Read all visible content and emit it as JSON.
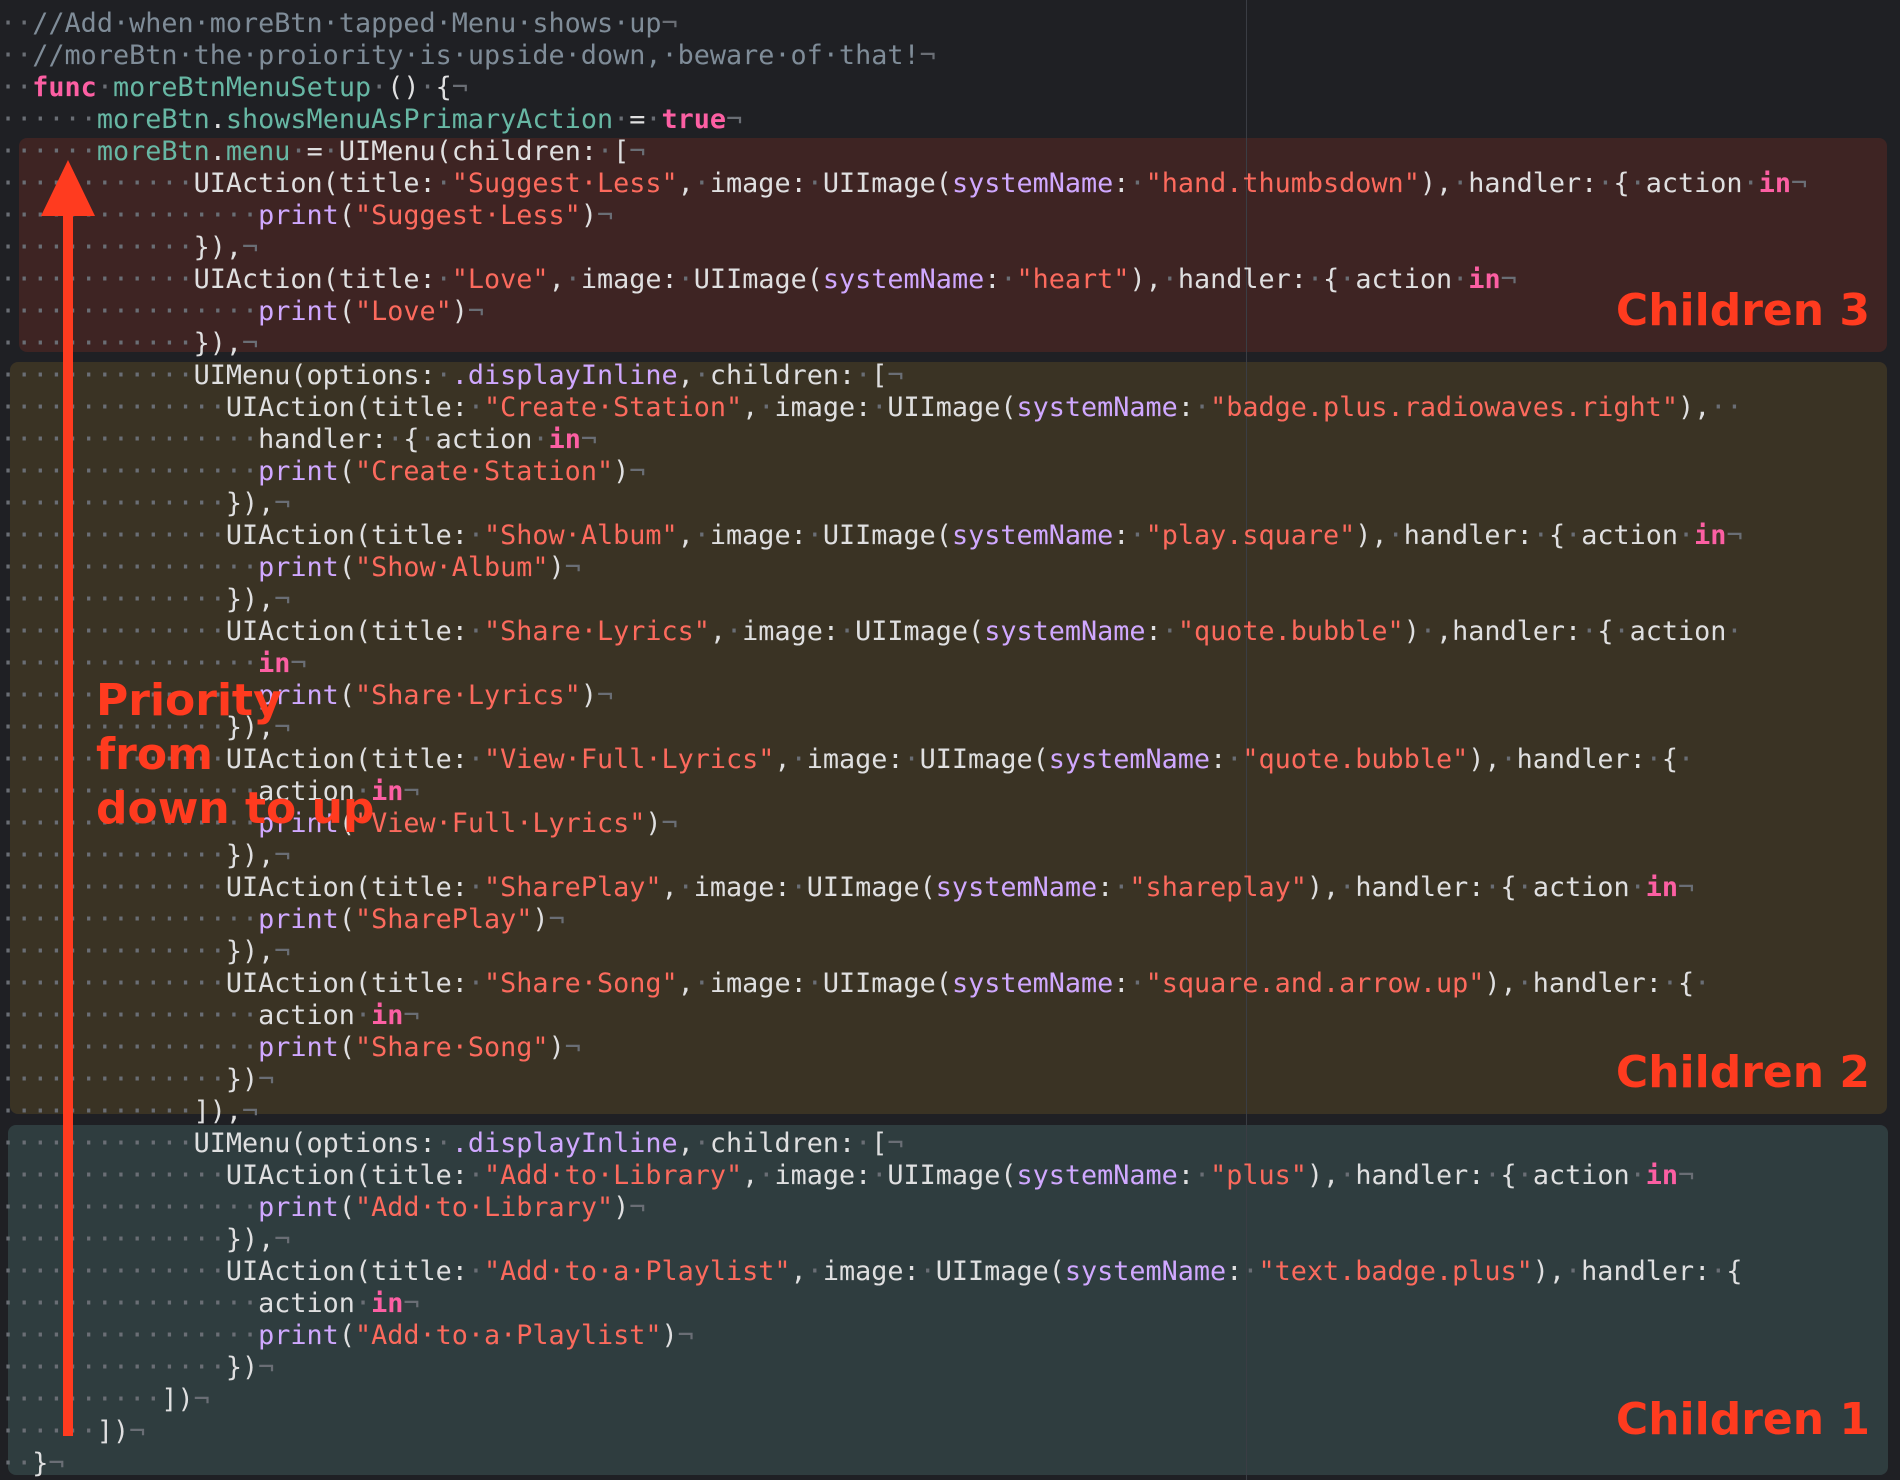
{
  "colors": {
    "background": "#1f2024",
    "region_children_3": "#3e2423",
    "region_children_2": "#3a3324",
    "region_children_1": "#2f3d3f",
    "annotation": "#ff3b1f",
    "keyword": "#fc5fa3",
    "string": "#fc6a5d",
    "type": "#d0a8ff",
    "property": "#67b7a4",
    "comment": "#7f8c98",
    "invisibles": "#6a6e75"
  },
  "annotations": {
    "children_3": "Children 3",
    "children_2": "Children 2",
    "children_1": "Children 1",
    "priority": "Priority\nfrom\ndown to up"
  },
  "code_lines": [
    [
      [
        "w",
        "··"
      ],
      [
        "c",
        "//Add·when·moreBtn·tapped·Menu·shows·up"
      ],
      [
        "p",
        "¬"
      ]
    ],
    [
      [
        "w",
        "··"
      ],
      [
        "c",
        "//moreBtn·the·proiority·is·upside·down,·beware·of·that!"
      ],
      [
        "p",
        "¬"
      ]
    ],
    [
      [
        "w",
        "··"
      ],
      [
        "k",
        "func"
      ],
      [
        "w",
        "·"
      ],
      [
        "f",
        "moreBtnMenuSetup"
      ],
      [
        "w",
        "·"
      ],
      [
        "t",
        "()"
      ],
      [
        "w",
        "·"
      ],
      [
        "t",
        "{"
      ],
      [
        "p",
        "¬"
      ]
    ],
    [
      [
        "w",
        "······"
      ],
      [
        "r",
        "moreBtn"
      ],
      [
        "t",
        "."
      ],
      [
        "r",
        "showsMenuAsPrimaryAction"
      ],
      [
        "w",
        "·"
      ],
      [
        "t",
        "="
      ],
      [
        "w",
        "·"
      ],
      [
        "k",
        "true"
      ],
      [
        "p",
        "¬"
      ]
    ],
    [
      [
        "w",
        "······"
      ],
      [
        "r",
        "moreBtn"
      ],
      [
        "t",
        "."
      ],
      [
        "r",
        "menu"
      ],
      [
        "w",
        "·"
      ],
      [
        "t",
        "="
      ],
      [
        "w",
        "·"
      ],
      [
        "t",
        "UIMenu(children:"
      ],
      [
        "w",
        "·"
      ],
      [
        "t",
        "["
      ],
      [
        "p",
        "¬"
      ]
    ],
    [
      [
        "w",
        "············"
      ],
      [
        "t",
        "UIAction(title:"
      ],
      [
        "w",
        "·"
      ],
      [
        "s",
        "\"Suggest·Less\""
      ],
      [
        "t",
        ","
      ],
      [
        "w",
        "·"
      ],
      [
        "t",
        "image:"
      ],
      [
        "w",
        "·"
      ],
      [
        "t",
        "UIImage("
      ],
      [
        "y",
        "systemName"
      ],
      [
        "t",
        ":"
      ],
      [
        "w",
        "·"
      ],
      [
        "s",
        "\"hand.thumbsdown\""
      ],
      [
        "t",
        "),"
      ],
      [
        "w",
        "·"
      ],
      [
        "t",
        "handler:"
      ],
      [
        "w",
        "·"
      ],
      [
        "t",
        "{"
      ],
      [
        "w",
        "·"
      ],
      [
        "t",
        "action"
      ],
      [
        "w",
        "·"
      ],
      [
        "k",
        "in"
      ],
      [
        "p",
        "¬"
      ]
    ],
    [
      [
        "w",
        "················"
      ],
      [
        "y",
        "print"
      ],
      [
        "t",
        "("
      ],
      [
        "s",
        "\"Suggest·Less\""
      ],
      [
        "t",
        ")"
      ],
      [
        "p",
        "¬"
      ]
    ],
    [
      [
        "w",
        "············"
      ],
      [
        "t",
        "}),"
      ],
      [
        "p",
        "¬"
      ]
    ],
    [
      [
        "w",
        "············"
      ],
      [
        "t",
        "UIAction(title:"
      ],
      [
        "w",
        "·"
      ],
      [
        "s",
        "\"Love\""
      ],
      [
        "t",
        ","
      ],
      [
        "w",
        "·"
      ],
      [
        "t",
        "image:"
      ],
      [
        "w",
        "·"
      ],
      [
        "t",
        "UIImage("
      ],
      [
        "y",
        "systemName"
      ],
      [
        "t",
        ":"
      ],
      [
        "w",
        "·"
      ],
      [
        "s",
        "\"heart\""
      ],
      [
        "t",
        "),"
      ],
      [
        "w",
        "·"
      ],
      [
        "t",
        "handler:"
      ],
      [
        "w",
        "·"
      ],
      [
        "t",
        "{"
      ],
      [
        "w",
        "·"
      ],
      [
        "t",
        "action"
      ],
      [
        "w",
        "·"
      ],
      [
        "k",
        "in"
      ],
      [
        "p",
        "¬"
      ]
    ],
    [
      [
        "w",
        "················"
      ],
      [
        "y",
        "print"
      ],
      [
        "t",
        "("
      ],
      [
        "s",
        "\"Love\""
      ],
      [
        "t",
        ")"
      ],
      [
        "p",
        "¬"
      ]
    ],
    [
      [
        "w",
        "············"
      ],
      [
        "t",
        "}),"
      ],
      [
        "p",
        "¬"
      ]
    ],
    [
      [
        "w",
        "············"
      ],
      [
        "t",
        "UIMenu(options:"
      ],
      [
        "w",
        "·"
      ],
      [
        "y",
        ".displayInline"
      ],
      [
        "t",
        ","
      ],
      [
        "w",
        "·"
      ],
      [
        "t",
        "children:"
      ],
      [
        "w",
        "·"
      ],
      [
        "t",
        "["
      ],
      [
        "p",
        "¬"
      ]
    ],
    [
      [
        "w",
        "··············"
      ],
      [
        "t",
        "UIAction(title:"
      ],
      [
        "w",
        "·"
      ],
      [
        "s",
        "\"Create·Station\""
      ],
      [
        "t",
        ","
      ],
      [
        "w",
        "·"
      ],
      [
        "t",
        "image:"
      ],
      [
        "w",
        "·"
      ],
      [
        "t",
        "UIImage("
      ],
      [
        "y",
        "systemName"
      ],
      [
        "t",
        ":"
      ],
      [
        "w",
        "·"
      ],
      [
        "s",
        "\"badge.plus.radiowaves.right\""
      ],
      [
        "t",
        "),"
      ],
      [
        "w",
        "··"
      ]
    ],
    [
      [
        "w",
        "················"
      ],
      [
        "t",
        "handler:"
      ],
      [
        "w",
        "·"
      ],
      [
        "t",
        "{"
      ],
      [
        "w",
        "·"
      ],
      [
        "t",
        "action"
      ],
      [
        "w",
        "·"
      ],
      [
        "k",
        "in"
      ],
      [
        "p",
        "¬"
      ]
    ],
    [
      [
        "w",
        "················"
      ],
      [
        "y",
        "print"
      ],
      [
        "t",
        "("
      ],
      [
        "s",
        "\"Create·Station\""
      ],
      [
        "t",
        ")"
      ],
      [
        "p",
        "¬"
      ]
    ],
    [
      [
        "w",
        "··············"
      ],
      [
        "t",
        "}),"
      ],
      [
        "p",
        "¬"
      ]
    ],
    [
      [
        "w",
        "··············"
      ],
      [
        "t",
        "UIAction(title:"
      ],
      [
        "w",
        "·"
      ],
      [
        "s",
        "\"Show·Album\""
      ],
      [
        "t",
        ","
      ],
      [
        "w",
        "·"
      ],
      [
        "t",
        "image:"
      ],
      [
        "w",
        "·"
      ],
      [
        "t",
        "UIImage("
      ],
      [
        "y",
        "systemName"
      ],
      [
        "t",
        ":"
      ],
      [
        "w",
        "·"
      ],
      [
        "s",
        "\"play.square\""
      ],
      [
        "t",
        "),"
      ],
      [
        "w",
        "·"
      ],
      [
        "t",
        "handler:"
      ],
      [
        "w",
        "·"
      ],
      [
        "t",
        "{"
      ],
      [
        "w",
        "·"
      ],
      [
        "t",
        "action"
      ],
      [
        "w",
        "·"
      ],
      [
        "k",
        "in"
      ],
      [
        "p",
        "¬"
      ]
    ],
    [
      [
        "w",
        "················"
      ],
      [
        "y",
        "print"
      ],
      [
        "t",
        "("
      ],
      [
        "s",
        "\"Show·Album\""
      ],
      [
        "t",
        ")"
      ],
      [
        "p",
        "¬"
      ]
    ],
    [
      [
        "w",
        "··············"
      ],
      [
        "t",
        "}),"
      ],
      [
        "p",
        "¬"
      ]
    ],
    [
      [
        "w",
        "··············"
      ],
      [
        "t",
        "UIAction(title:"
      ],
      [
        "w",
        "·"
      ],
      [
        "s",
        "\"Share·Lyrics\""
      ],
      [
        "t",
        ","
      ],
      [
        "w",
        "·"
      ],
      [
        "t",
        "image:"
      ],
      [
        "w",
        "·"
      ],
      [
        "t",
        "UIImage("
      ],
      [
        "y",
        "systemName"
      ],
      [
        "t",
        ":"
      ],
      [
        "w",
        "·"
      ],
      [
        "s",
        "\"quote.bubble\""
      ],
      [
        "t",
        ")"
      ],
      [
        "w",
        "·"
      ],
      [
        "t",
        ",handler:"
      ],
      [
        "w",
        "·"
      ],
      [
        "t",
        "{"
      ],
      [
        "w",
        "·"
      ],
      [
        "t",
        "action"
      ],
      [
        "w",
        "·"
      ]
    ],
    [
      [
        "w",
        "················"
      ],
      [
        "k",
        "in"
      ],
      [
        "p",
        "¬"
      ]
    ],
    [
      [
        "w",
        "················"
      ],
      [
        "y",
        "print"
      ],
      [
        "t",
        "("
      ],
      [
        "s",
        "\"Share·Lyrics\""
      ],
      [
        "t",
        ")"
      ],
      [
        "p",
        "¬"
      ]
    ],
    [
      [
        "w",
        "··············"
      ],
      [
        "t",
        "}),"
      ],
      [
        "p",
        "¬"
      ]
    ],
    [
      [
        "w",
        "··············"
      ],
      [
        "t",
        "UIAction(title:"
      ],
      [
        "w",
        "·"
      ],
      [
        "s",
        "\"View·Full·Lyrics\""
      ],
      [
        "t",
        ","
      ],
      [
        "w",
        "·"
      ],
      [
        "t",
        "image:"
      ],
      [
        "w",
        "·"
      ],
      [
        "t",
        "UIImage("
      ],
      [
        "y",
        "systemName"
      ],
      [
        "t",
        ":"
      ],
      [
        "w",
        "·"
      ],
      [
        "s",
        "\"quote.bubble\""
      ],
      [
        "t",
        "),"
      ],
      [
        "w",
        "·"
      ],
      [
        "t",
        "handler:"
      ],
      [
        "w",
        "·"
      ],
      [
        "t",
        "{"
      ],
      [
        "w",
        "·"
      ]
    ],
    [
      [
        "w",
        "················"
      ],
      [
        "t",
        "action"
      ],
      [
        "w",
        "·"
      ],
      [
        "k",
        "in"
      ],
      [
        "p",
        "¬"
      ]
    ],
    [
      [
        "w",
        "················"
      ],
      [
        "y",
        "print"
      ],
      [
        "t",
        "("
      ],
      [
        "s",
        "\"View·Full·Lyrics\""
      ],
      [
        "t",
        ")"
      ],
      [
        "p",
        "¬"
      ]
    ],
    [
      [
        "w",
        "··············"
      ],
      [
        "t",
        "}),"
      ],
      [
        "p",
        "¬"
      ]
    ],
    [
      [
        "w",
        "··············"
      ],
      [
        "t",
        "UIAction(title:"
      ],
      [
        "w",
        "·"
      ],
      [
        "s",
        "\"SharePlay\""
      ],
      [
        "t",
        ","
      ],
      [
        "w",
        "·"
      ],
      [
        "t",
        "image:"
      ],
      [
        "w",
        "·"
      ],
      [
        "t",
        "UIImage("
      ],
      [
        "y",
        "systemName"
      ],
      [
        "t",
        ":"
      ],
      [
        "w",
        "·"
      ],
      [
        "s",
        "\"shareplay\""
      ],
      [
        "t",
        "),"
      ],
      [
        "w",
        "·"
      ],
      [
        "t",
        "handler:"
      ],
      [
        "w",
        "·"
      ],
      [
        "t",
        "{"
      ],
      [
        "w",
        "·"
      ],
      [
        "t",
        "action"
      ],
      [
        "w",
        "·"
      ],
      [
        "k",
        "in"
      ],
      [
        "p",
        "¬"
      ]
    ],
    [
      [
        "w",
        "················"
      ],
      [
        "y",
        "print"
      ],
      [
        "t",
        "("
      ],
      [
        "s",
        "\"SharePlay\""
      ],
      [
        "t",
        ")"
      ],
      [
        "p",
        "¬"
      ]
    ],
    [
      [
        "w",
        "··············"
      ],
      [
        "t",
        "}),"
      ],
      [
        "p",
        "¬"
      ]
    ],
    [
      [
        "w",
        "··············"
      ],
      [
        "t",
        "UIAction(title:"
      ],
      [
        "w",
        "·"
      ],
      [
        "s",
        "\"Share·Song\""
      ],
      [
        "t",
        ","
      ],
      [
        "w",
        "·"
      ],
      [
        "t",
        "image:"
      ],
      [
        "w",
        "·"
      ],
      [
        "t",
        "UIImage("
      ],
      [
        "y",
        "systemName"
      ],
      [
        "t",
        ":"
      ],
      [
        "w",
        "·"
      ],
      [
        "s",
        "\"square.and.arrow.up\""
      ],
      [
        "t",
        "),"
      ],
      [
        "w",
        "·"
      ],
      [
        "t",
        "handler:"
      ],
      [
        "w",
        "·"
      ],
      [
        "t",
        "{"
      ],
      [
        "w",
        "·"
      ]
    ],
    [
      [
        "w",
        "················"
      ],
      [
        "t",
        "action"
      ],
      [
        "w",
        "·"
      ],
      [
        "k",
        "in"
      ],
      [
        "p",
        "¬"
      ]
    ],
    [
      [
        "w",
        "················"
      ],
      [
        "y",
        "print"
      ],
      [
        "t",
        "("
      ],
      [
        "s",
        "\"Share·Song\""
      ],
      [
        "t",
        ")"
      ],
      [
        "p",
        "¬"
      ]
    ],
    [
      [
        "w",
        "··············"
      ],
      [
        "t",
        "})"
      ],
      [
        "p",
        "¬"
      ]
    ],
    [
      [
        "w",
        "············"
      ],
      [
        "t",
        "]),"
      ],
      [
        "p",
        "¬"
      ]
    ],
    [
      [
        "w",
        "············"
      ],
      [
        "t",
        "UIMenu(options:"
      ],
      [
        "w",
        "·"
      ],
      [
        "y",
        ".displayInline"
      ],
      [
        "t",
        ","
      ],
      [
        "w",
        "·"
      ],
      [
        "t",
        "children:"
      ],
      [
        "w",
        "·"
      ],
      [
        "t",
        "["
      ],
      [
        "p",
        "¬"
      ]
    ],
    [
      [
        "w",
        "··············"
      ],
      [
        "t",
        "UIAction(title:"
      ],
      [
        "w",
        "·"
      ],
      [
        "s",
        "\"Add·to·Library\""
      ],
      [
        "t",
        ","
      ],
      [
        "w",
        "·"
      ],
      [
        "t",
        "image:"
      ],
      [
        "w",
        "·"
      ],
      [
        "t",
        "UIImage("
      ],
      [
        "y",
        "systemName"
      ],
      [
        "t",
        ":"
      ],
      [
        "w",
        "·"
      ],
      [
        "s",
        "\"plus\""
      ],
      [
        "t",
        "),"
      ],
      [
        "w",
        "·"
      ],
      [
        "t",
        "handler:"
      ],
      [
        "w",
        "·"
      ],
      [
        "t",
        "{"
      ],
      [
        "w",
        "·"
      ],
      [
        "t",
        "action"
      ],
      [
        "w",
        "·"
      ],
      [
        "k",
        "in"
      ],
      [
        "p",
        "¬"
      ]
    ],
    [
      [
        "w",
        "················"
      ],
      [
        "y",
        "print"
      ],
      [
        "t",
        "("
      ],
      [
        "s",
        "\"Add·to·Library\""
      ],
      [
        "t",
        ")"
      ],
      [
        "p",
        "¬"
      ]
    ],
    [
      [
        "w",
        "··············"
      ],
      [
        "t",
        "}),"
      ],
      [
        "p",
        "¬"
      ]
    ],
    [
      [
        "w",
        "··············"
      ],
      [
        "t",
        "UIAction(title:"
      ],
      [
        "w",
        "·"
      ],
      [
        "s",
        "\"Add·to·a·Playlist\""
      ],
      [
        "t",
        ","
      ],
      [
        "w",
        "·"
      ],
      [
        "t",
        "image:"
      ],
      [
        "w",
        "·"
      ],
      [
        "t",
        "UIImage("
      ],
      [
        "y",
        "systemName"
      ],
      [
        "t",
        ":"
      ],
      [
        "w",
        "·"
      ],
      [
        "s",
        "\"text.badge.plus\""
      ],
      [
        "t",
        "),"
      ],
      [
        "w",
        "·"
      ],
      [
        "t",
        "handler:"
      ],
      [
        "w",
        "·"
      ],
      [
        "t",
        "{"
      ]
    ],
    [
      [
        "w",
        "················"
      ],
      [
        "t",
        "action"
      ],
      [
        "w",
        "·"
      ],
      [
        "k",
        "in"
      ],
      [
        "p",
        "¬"
      ]
    ],
    [
      [
        "w",
        "················"
      ],
      [
        "y",
        "print"
      ],
      [
        "t",
        "("
      ],
      [
        "s",
        "\"Add·to·a·Playlist\""
      ],
      [
        "t",
        ")"
      ],
      [
        "p",
        "¬"
      ]
    ],
    [
      [
        "w",
        "··············"
      ],
      [
        "t",
        "})"
      ],
      [
        "p",
        "¬"
      ]
    ],
    [
      [
        "w",
        "··········"
      ],
      [
        "t",
        "])"
      ],
      [
        "p",
        "¬"
      ]
    ],
    [
      [
        "w",
        "······"
      ],
      [
        "t",
        "])"
      ],
      [
        "p",
        "¬"
      ]
    ],
    [
      [
        "w",
        "··"
      ],
      [
        "t",
        "}"
      ],
      [
        "p",
        "¬"
      ]
    ]
  ]
}
